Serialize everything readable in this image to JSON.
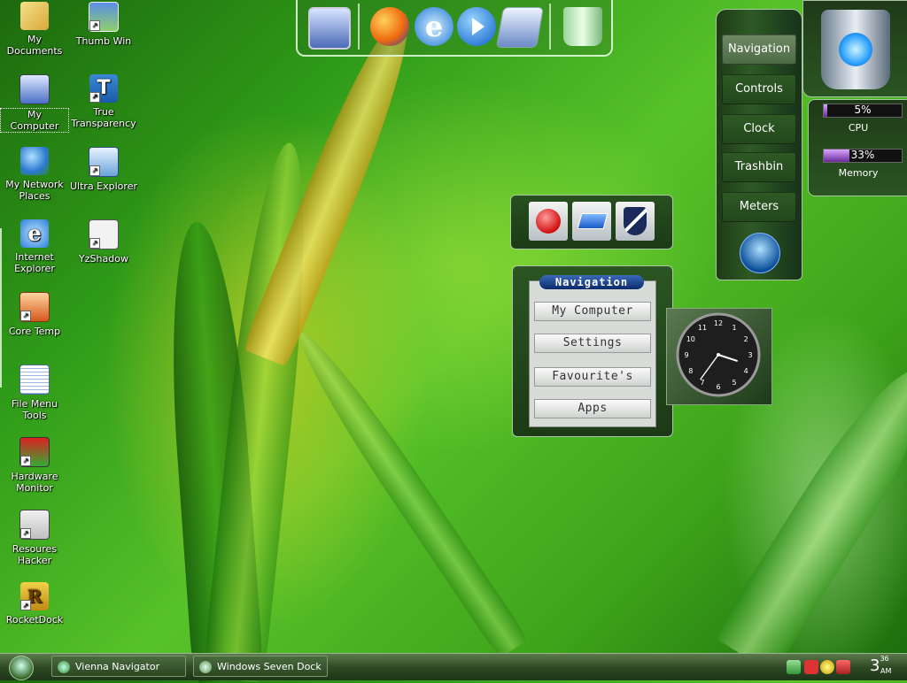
{
  "desktop_icons": [
    {
      "label": "My Documents"
    },
    {
      "label": "Thumb Win"
    },
    {
      "label": "My Computer"
    },
    {
      "label": "True Transparency"
    },
    {
      "label": "My Network Places"
    },
    {
      "label": "Ultra Explorer"
    },
    {
      "label": "Internet Explorer"
    },
    {
      "label": "YzShadow"
    },
    {
      "label": "Core Temp"
    },
    {
      "label": "File Menu Tools"
    },
    {
      "label": "Hardware Monitor"
    },
    {
      "label": "Resoures Hacker"
    },
    {
      "label": "RocketDock"
    }
  ],
  "dock": {
    "items": [
      "monitor-icon",
      "firefox-icon",
      "internet-explorer-icon",
      "media-player-icon",
      "control-panel-icon",
      "recycle-bin-icon"
    ]
  },
  "gadget_bar": {
    "buttons": [
      "Navigation",
      "Controls",
      "Clock",
      "Trashbin",
      "Meters"
    ]
  },
  "meters": {
    "cpu": {
      "value": "5%",
      "label": "CPU",
      "fill": 0.05
    },
    "memory": {
      "value": "33%",
      "label": "Memory",
      "fill": 0.33
    }
  },
  "navigation_gadget": {
    "title": "Navigation",
    "buttons": [
      "My Computer",
      "Settings",
      "Favourite's",
      "Apps"
    ]
  },
  "clock": {
    "numbers": [
      "12",
      "1",
      "2",
      "3",
      "4",
      "5",
      "6",
      "7",
      "8",
      "9",
      "10",
      "11"
    ],
    "hour": 3,
    "minute": 36
  },
  "taskbar": {
    "tasks": [
      "Vienna Navigator",
      "Windows Seven Dock"
    ],
    "time_main": "3",
    "time_minutes": "36",
    "time_ampm": "AM"
  },
  "colors": {
    "accent": "#2e5a24",
    "nav_title": "#0a2a6a"
  }
}
